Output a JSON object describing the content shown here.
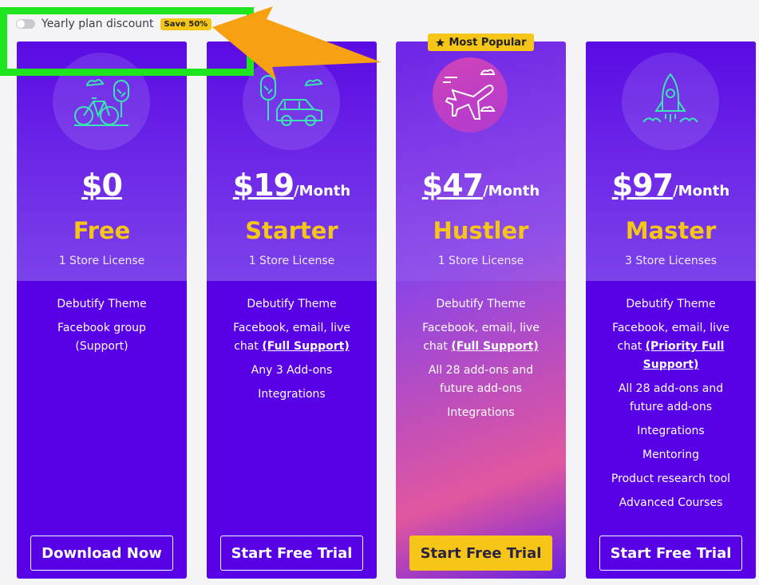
{
  "toggle": {
    "label": "Yearly plan discount",
    "badge": "Save 50%"
  },
  "popular_badge": {
    "icon": "star-icon",
    "label": "Most Popular"
  },
  "colors": {
    "card": "#5800e6",
    "accent": "#f5c518",
    "highlight": "#1ee51e",
    "arrow": "#f7a011"
  },
  "plans": [
    {
      "icon": "bicycle-tree-icon",
      "amount": "$0",
      "period": "",
      "name": "Free",
      "license": "1 Store License",
      "features": [
        "Debutify Theme",
        "Facebook group (Support)"
      ],
      "cta": "Download Now"
    },
    {
      "icon": "car-tree-icon",
      "amount": "$19",
      "period": "/Month",
      "name": "Starter",
      "license": "1 Store License",
      "features": [
        "Debutify Theme",
        "Facebook, email, live chat",
        "Any 3 Add-ons",
        "Integrations"
      ],
      "support_link": "(Full Support)",
      "cta": "Start Free Trial"
    },
    {
      "icon": "airplane-icon",
      "amount": "$47",
      "period": "/Month",
      "name": "Hustler",
      "license": "1 Store License",
      "features": [
        "Debutify Theme",
        "Facebook, email, live chat",
        "All 28 add-ons and future add-ons",
        "Integrations"
      ],
      "support_link": "(Full Support)",
      "cta": "Start Free Trial"
    },
    {
      "icon": "rocket-icon",
      "amount": "$97",
      "period": "/Month",
      "name": "Master",
      "license": "3 Store Licenses",
      "features": [
        "Debutify Theme",
        "Facebook, email, live chat",
        "All 28 add-ons and future add-ons",
        "Integrations",
        "Mentoring",
        "Product research tool",
        "Advanced Courses"
      ],
      "support_link": "(Priority Full Support)",
      "cta": "Start Free Trial"
    }
  ]
}
